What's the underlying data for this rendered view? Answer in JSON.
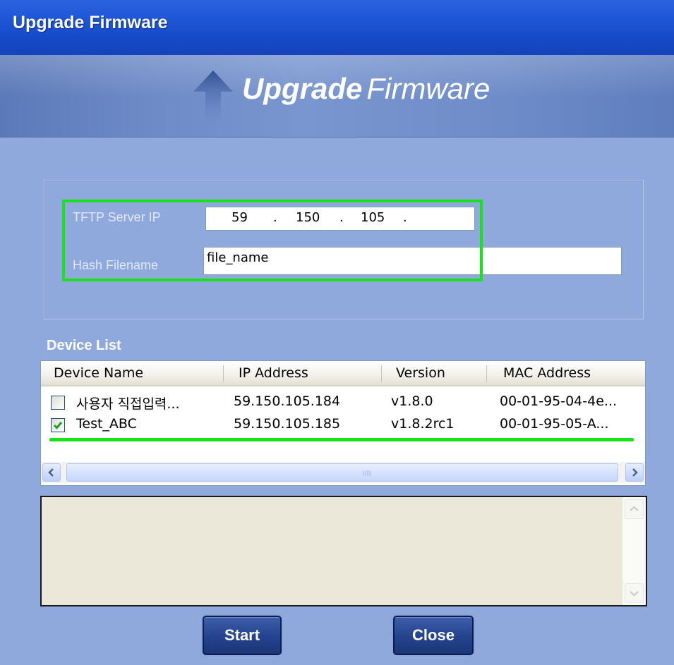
{
  "window": {
    "title": "Upgrade Firmware"
  },
  "banner": {
    "title_bold": "Upgrade",
    "title_light": "Firmware",
    "icon": "up-arrow-icon"
  },
  "settings": {
    "tftp_label": "TFTP Server IP",
    "ip_octets": [
      "59",
      "150",
      "105",
      ""
    ],
    "ip_separator": ".",
    "hash_label": "Hash Filename",
    "hash_value": "file_name"
  },
  "device_list": {
    "title": "Device List",
    "columns": [
      "Device Name",
      "IP Address",
      "Version",
      "MAC Address"
    ],
    "rows": [
      {
        "checked": false,
        "name": "사용자 직접입력...",
        "ip": "59.150.105.184",
        "version": "v1.8.0",
        "mac": "00-01-95-04-4e..."
      },
      {
        "checked": true,
        "name": "Test_ABC",
        "ip": "59.150.105.185",
        "version": "v1.8.2rc1",
        "mac": "00-01-95-05-A..."
      }
    ]
  },
  "log": {
    "text": ""
  },
  "buttons": {
    "start": "Start",
    "close": "Close"
  },
  "colors": {
    "highlight": "#17e21a",
    "titlebar": "#1f56d6",
    "background": "#90a9dc"
  }
}
